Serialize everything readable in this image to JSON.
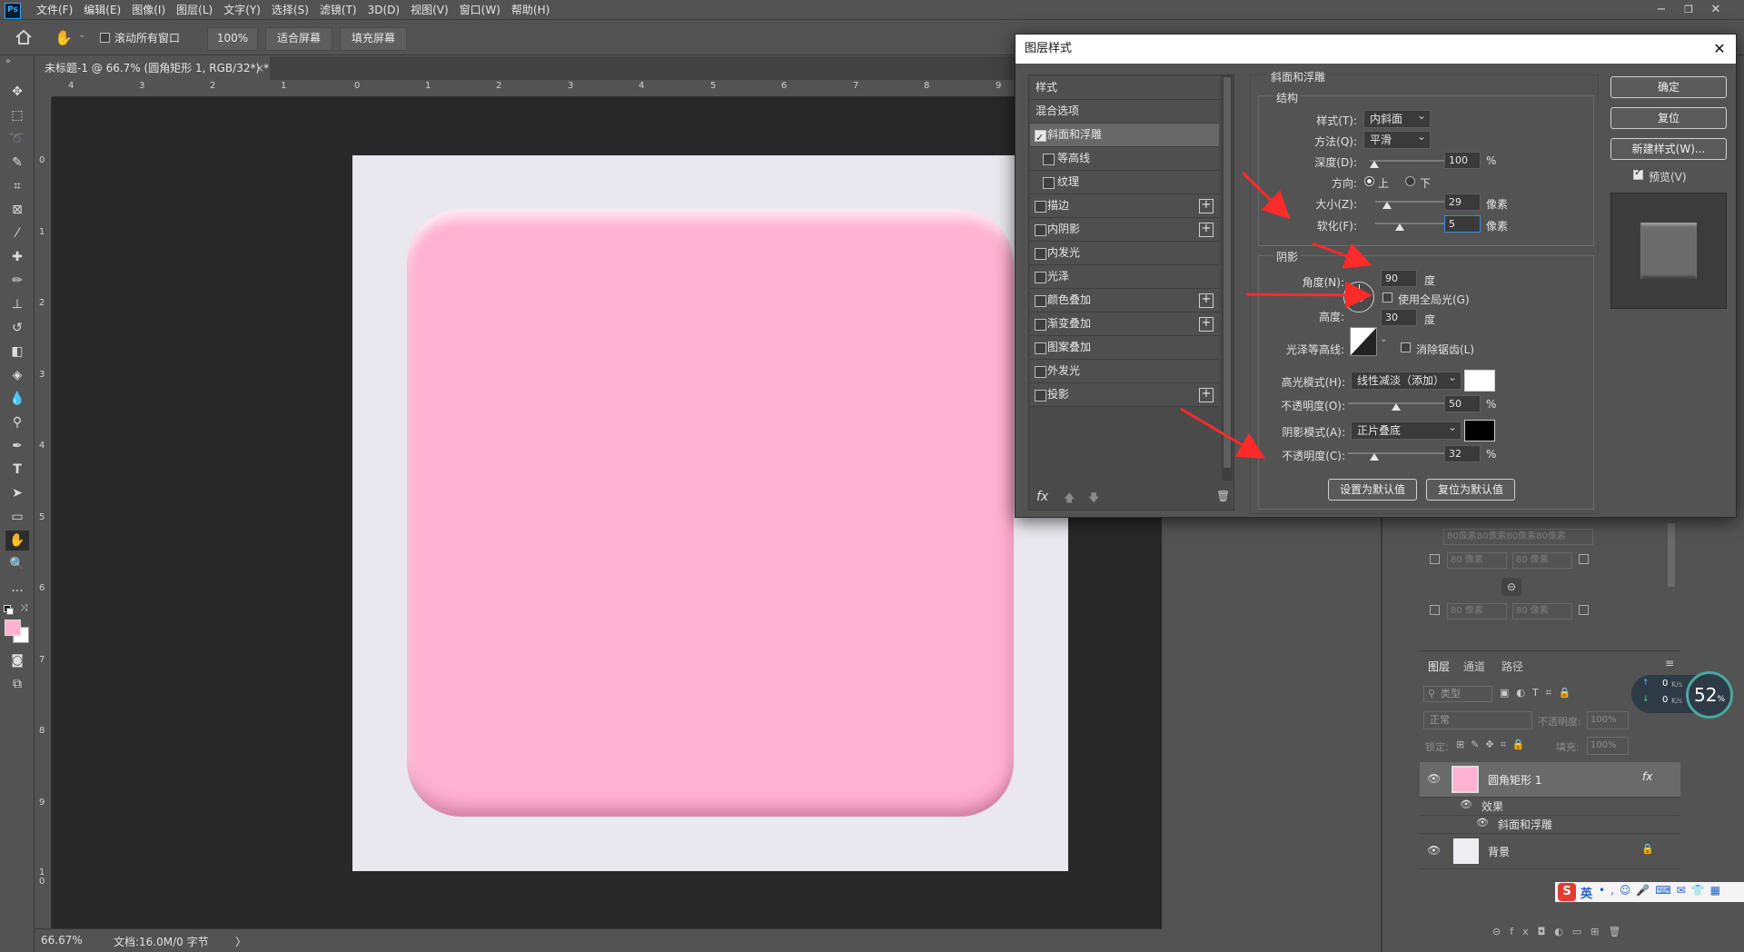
{
  "menubar": {
    "logo": "Ps",
    "items": [
      "文件(F)",
      "编辑(E)",
      "图像(I)",
      "图层(L)",
      "文字(Y)",
      "选择(S)",
      "滤镜(T)",
      "3D(D)",
      "视图(V)",
      "窗口(W)",
      "帮助(H)"
    ]
  },
  "optionsbar": {
    "scroll_all_label": "滚动所有窗口",
    "zoom_value": "100%",
    "fit_screen": "适合屏幕",
    "fill_screen": "填充屏幕"
  },
  "document": {
    "tab_title": "未标题-1 @ 66.7% (圆角矩形 1, RGB/32*) *",
    "shape_color": "#ffb1d1",
    "background_color": "#e8e8ee"
  },
  "rulers": {
    "h_labels": [
      "4",
      "3",
      "2",
      "1",
      "0",
      "1",
      "2",
      "3",
      "4",
      "5",
      "6",
      "7",
      "8",
      "9"
    ],
    "v_labels": [
      "0",
      "1",
      "2",
      "3",
      "4",
      "5",
      "6",
      "7",
      "8",
      "9",
      "1 0"
    ]
  },
  "statusbar": {
    "zoom": "66.67%",
    "doc_info": "文档:16.0M/0 字节",
    "arrow": "〉"
  },
  "dialog": {
    "title": "图层样式",
    "styles": [
      {
        "label": "样式",
        "checkbox": false,
        "plus": false
      },
      {
        "label": "混合选项",
        "checkbox": false,
        "plus": false
      },
      {
        "label": "斜面和浮雕",
        "checkbox": true,
        "checked": true,
        "plus": false,
        "selected": true
      },
      {
        "label": "等高线",
        "checkbox": true,
        "checked": false,
        "plus": false,
        "indent": true
      },
      {
        "label": "纹理",
        "checkbox": true,
        "checked": false,
        "plus": false,
        "indent": true
      },
      {
        "label": "描边",
        "checkbox": true,
        "checked": false,
        "plus": true
      },
      {
        "label": "内阴影",
        "checkbox": true,
        "checked": false,
        "plus": true
      },
      {
        "label": "内发光",
        "checkbox": true,
        "checked": false,
        "plus": false
      },
      {
        "label": "光泽",
        "checkbox": true,
        "checked": false,
        "plus": false
      },
      {
        "label": "颜色叠加",
        "checkbox": true,
        "checked": false,
        "plus": true
      },
      {
        "label": "渐变叠加",
        "checkbox": true,
        "checked": false,
        "plus": true
      },
      {
        "label": "图案叠加",
        "checkbox": true,
        "checked": false,
        "plus": false
      },
      {
        "label": "外发光",
        "checkbox": true,
        "checked": false,
        "plus": false
      },
      {
        "label": "投影",
        "checkbox": true,
        "checked": false,
        "plus": true
      }
    ],
    "fx_label": "fx",
    "section_title": "斜面和浮雕",
    "structure": {
      "title": "结构",
      "style_label": "样式(T):",
      "style_value": "内斜面",
      "technique_label": "方法(Q):",
      "technique_value": "平滑",
      "depth_label": "深度(D):",
      "depth_value": "100",
      "depth_unit": "%",
      "direction_label": "方向:",
      "dir_up": "上",
      "dir_down": "下",
      "size_label": "大小(Z):",
      "size_value": "29",
      "size_unit": "像素",
      "soften_label": "软化(F):",
      "soften_value": "5",
      "soften_unit": "像素"
    },
    "shading": {
      "title": "阴影",
      "angle_label": "角度(N):",
      "angle_value": "90",
      "angle_unit": "度",
      "global_light_label": "使用全局光(G)",
      "altitude_label": "高度:",
      "altitude_value": "30",
      "altitude_unit": "度",
      "gloss_label": "光泽等高线:",
      "antialias_label": "消除锯齿(L)",
      "highlight_mode_label": "高光模式(H):",
      "highlight_mode_value": "线性减淡（添加）",
      "highlight_color": "#ffffff",
      "hl_opacity_label": "不透明度(O):",
      "hl_opacity_value": "50",
      "hl_opacity_unit": "%",
      "shadow_mode_label": "阴影模式(A):",
      "shadow_mode_value": "正片叠底",
      "shadow_color": "#000000",
      "sh_opacity_label": "不透明度(C):",
      "sh_opacity_value": "32",
      "sh_opacity_unit": "%"
    },
    "set_default": "设置为默认值",
    "reset_default": "复位为默认值",
    "ok": "确定",
    "reset": "复位",
    "new_style": "新建样式(W)...",
    "preview_label": "预览(V)"
  },
  "properties": {
    "fields": [
      "80像素80像素80像素80像素",
      "80 像素",
      "80 像素",
      "80 像素",
      "80 像素"
    ]
  },
  "layers": {
    "tabs": [
      "图层",
      "通道",
      "路径"
    ],
    "filter_label": "类型",
    "blend_mode": "正常",
    "opacity_label": "不透明度:",
    "opacity_value": "100%",
    "lock_label": "锁定:",
    "fill_label": "填充:",
    "fill_value": "100%",
    "rows": [
      {
        "name": "圆角矩形 1",
        "fx": "fx"
      },
      {
        "name": "效果"
      },
      {
        "name": "斜面和浮雕"
      },
      {
        "name": "背景"
      }
    ]
  },
  "speed": {
    "up": "0",
    "down": "0",
    "unit": "K/s",
    "percent": "52",
    "percent_unit": "%"
  },
  "ime": {
    "label": "英"
  }
}
